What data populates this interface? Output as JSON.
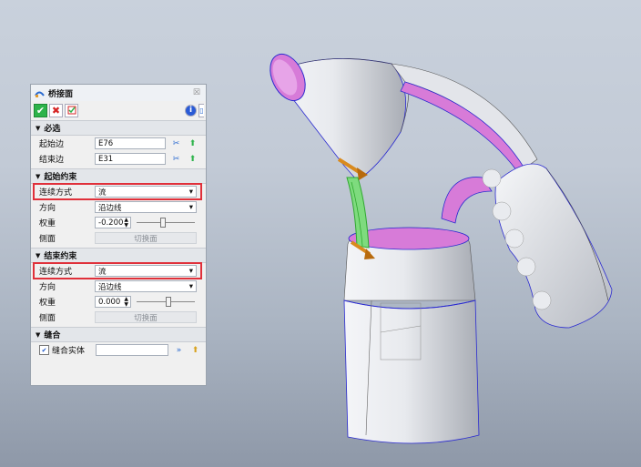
{
  "dialog": {
    "title": "桥接面",
    "close_glyph": "☒",
    "sections": {
      "required": "必选",
      "start_constraint": "起始约束",
      "end_constraint": "结束约束",
      "stitch": "缝合"
    },
    "fields": {
      "start_edge_label": "起始边",
      "start_edge_value": "E76",
      "end_edge_label": "结束边",
      "end_edge_value": "E31"
    },
    "start": {
      "continuity_label": "连续方式",
      "continuity_value": "流",
      "direction_label": "方向",
      "direction_value": "沿边线",
      "weight_label": "权重",
      "weight_value": "-0.200",
      "weight_level": 0.45,
      "side_label": "侧面",
      "switch_label": "切换面"
    },
    "end": {
      "continuity_label": "连续方式",
      "continuity_value": "流",
      "direction_label": "方向",
      "direction_value": "沿边线",
      "weight_label": "权重",
      "weight_value": "0.000",
      "weight_level": 0.55,
      "side_label": "侧面",
      "switch_label": "切换面"
    },
    "stitch": {
      "label": "缝合实体",
      "checked": true,
      "value": ""
    },
    "colors": {
      "highlight": "#e0303a",
      "ok": "#2db34a",
      "cancel": "#d62424",
      "info": "#2a5bd6"
    },
    "icons": [
      "bridge-surface-icon",
      "ok-icon",
      "cancel-icon",
      "apply-icon",
      "info-icon",
      "help-icon",
      "pick-icon",
      "accept-icon",
      "dropdown-arrow-icon",
      "spinner-icon"
    ]
  },
  "viewport": {
    "model": "3d-bridge-surface-part",
    "colors": {
      "body": "#e6e8ec",
      "face": "#d77bd8",
      "bridge": "#3fc23f",
      "edge": "#2a2ad0",
      "marker": "#d98a1e"
    }
  }
}
